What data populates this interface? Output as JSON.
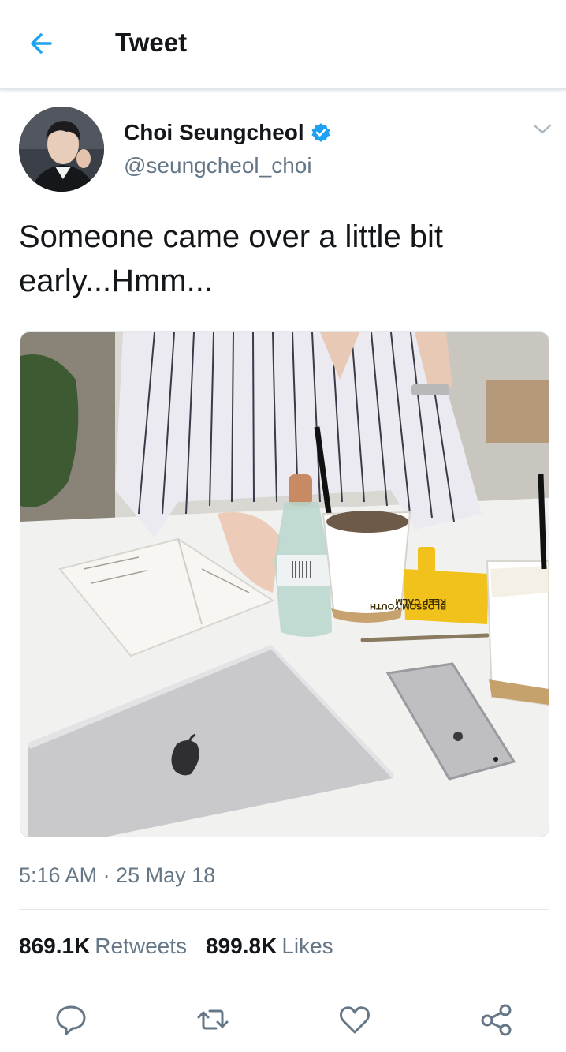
{
  "header": {
    "title": "Tweet"
  },
  "author": {
    "name": "Choi Seungcheol",
    "handle": "@seungcheol_choi",
    "verified": true
  },
  "tweet": {
    "text_line1": "Someone came over a little bit",
    "text_line2": "early...Hmm...",
    "timestamp": "5:16 AM · 25 May 18"
  },
  "stats": {
    "retweets_count": "869.1K",
    "retweets_label": "Retweets",
    "likes_count": "899.8K",
    "likes_label": "Likes"
  },
  "media_labels": {
    "notebook_text": "KEEP CALM BLOSSOM YOUTH"
  },
  "colors": {
    "accent": "#1da1f2",
    "secondary_text": "#657786",
    "divider": "#e1e8ed"
  },
  "icons": [
    "back-arrow-icon",
    "verified-badge-icon",
    "chevron-down-icon",
    "reply-icon",
    "retweet-icon",
    "like-icon",
    "share-icon"
  ]
}
